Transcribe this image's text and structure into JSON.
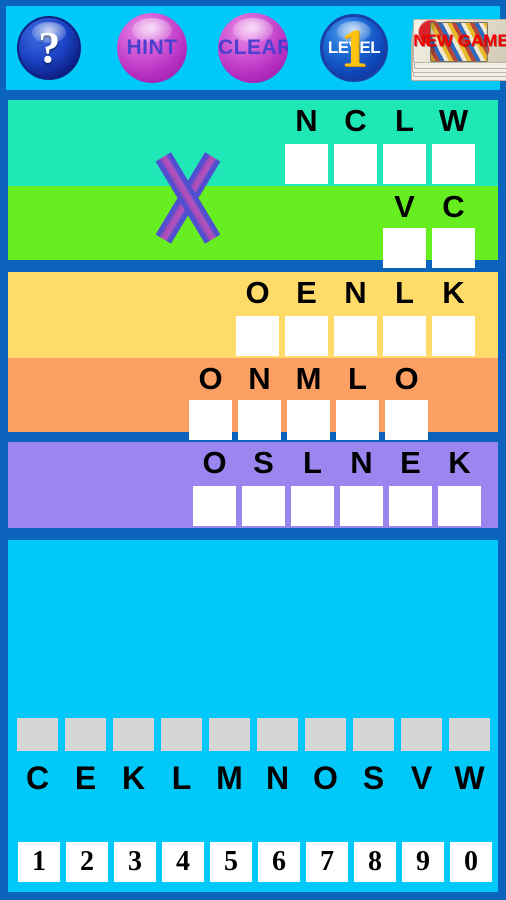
{
  "toolbar": {
    "help_label": "?",
    "hint_label": "HINT",
    "clear_label": "CLEAR",
    "level_label": "LEVEL",
    "level_number": "1",
    "new_game_label": "NEW GAME"
  },
  "puzzle": {
    "operator": "x",
    "panels": [
      {
        "name": "multiplication-panel",
        "rows": [
          {
            "color": "#1fe7b6",
            "letters": [
              "N",
              "C",
              "L",
              "W"
            ],
            "tiles": 4,
            "values": [
              "",
              "",
              "",
              ""
            ]
          },
          {
            "color": "#66ee20",
            "letters": [
              "V",
              "C"
            ],
            "tiles": 2,
            "values": [
              "",
              ""
            ]
          }
        ]
      },
      {
        "name": "partial-products-panel",
        "rows": [
          {
            "color": "#ffdb69",
            "letters": [
              "O",
              "E",
              "N",
              "L",
              "K"
            ],
            "tiles": 5,
            "values": [
              "",
              "",
              "",
              "",
              ""
            ]
          },
          {
            "color": "#fb9f62",
            "letters": [
              "O",
              "N",
              "M",
              "L",
              "O"
            ],
            "tiles": 5,
            "values": [
              "",
              "",
              "",
              "",
              ""
            ]
          }
        ]
      },
      {
        "name": "total-panel",
        "rows": [
          {
            "color": "#9b86f0",
            "letters": [
              "O",
              "S",
              "L",
              "N",
              "E",
              "K"
            ],
            "tiles": 6,
            "values": [
              "",
              "",
              "",
              "",
              "",
              ""
            ]
          }
        ]
      }
    ]
  },
  "keypad": {
    "slots": [
      "",
      "",
      "",
      "",
      "",
      "",
      "",
      "",
      "",
      ""
    ],
    "letters": [
      "C",
      "E",
      "K",
      "L",
      "M",
      "N",
      "O",
      "S",
      "V",
      "W"
    ],
    "numbers": [
      "1",
      "2",
      "3",
      "4",
      "5",
      "6",
      "7",
      "8",
      "9",
      "0"
    ]
  },
  "colors": {
    "frame": "#0b63bd",
    "toolbar_bg": "#00c8f8",
    "panel_bg": "#00c8f8",
    "tile": "#ffffff",
    "slot": "#d6d6d6"
  }
}
